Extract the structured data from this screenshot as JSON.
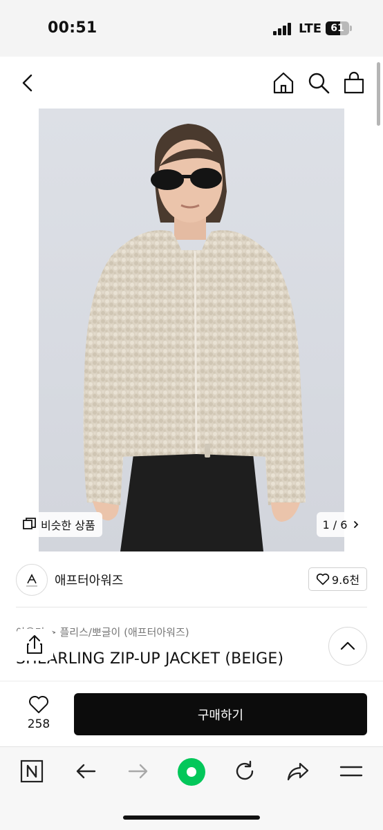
{
  "status_bar": {
    "time": "00:51",
    "network": "LTE",
    "battery": "61",
    "battery_level": 0.61
  },
  "header": {
    "icons": [
      "back-icon",
      "home-icon",
      "search-icon",
      "shopping-bag-icon"
    ]
  },
  "product_image": {
    "similar_label": "비슷한 상품",
    "pager": "1 / 6"
  },
  "brand": {
    "name": "애프터아워즈",
    "likes": "9.6천"
  },
  "product": {
    "category": "아우터 > 플리스/뽀글이 (애프터아워즈)",
    "title": "SHEARLING ZIP-UP JACKET (BEIGE)"
  },
  "purchase": {
    "wish_count": "258",
    "buy_label": "구매하기"
  },
  "browser_bar": {
    "icons": [
      "naver-n-icon",
      "back-arrow-icon",
      "forward-arrow-icon",
      "green-dot-icon",
      "reload-icon",
      "share-icon",
      "menu-icon"
    ]
  },
  "colors": {
    "buy_button": "#0c0c0c",
    "green_dot": "#03c75a",
    "image_bg": "#d9dce3"
  }
}
